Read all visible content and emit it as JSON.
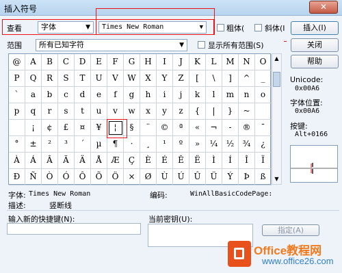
{
  "window": {
    "title": "插入符号",
    "close_glyph": "✕"
  },
  "toolbar": {
    "view_label": "查看",
    "font_mode_value": "字体",
    "font_name_value": "Times New Roman",
    "bold_label": "粗体(",
    "italic_label": "斜体(I",
    "insert_button": "插入(I)",
    "close_button": "关闭",
    "help_button": "帮助"
  },
  "range": {
    "label": "范围",
    "value": "所有已知字符",
    "show_all_label": "显示所有范围(S)"
  },
  "grid": {
    "rows": [
      [
        "@",
        "A",
        "B",
        "C",
        "D",
        "E",
        "F",
        "G",
        "H",
        "I",
        "J",
        "K",
        "L",
        "M",
        "N",
        "O"
      ],
      [
        "P",
        "Q",
        "R",
        "S",
        "T",
        "U",
        "V",
        "W",
        "X",
        "Y",
        "Z",
        "[",
        "\\",
        "]",
        "^",
        "_"
      ],
      [
        "`",
        "a",
        "b",
        "c",
        "d",
        "e",
        "f",
        "g",
        "h",
        "i",
        "j",
        "k",
        "l",
        "m",
        "n",
        "o"
      ],
      [
        "p",
        "q",
        "r",
        "s",
        "t",
        "u",
        "v",
        "w",
        "x",
        "y",
        "z",
        "{",
        "|",
        "}",
        "~",
        ""
      ],
      [
        "",
        "¡",
        "¢",
        "£",
        "¤",
        "¥",
        "¦",
        "§",
        "¨",
        "©",
        "ª",
        "«",
        "¬",
        "-",
        "®",
        "¯"
      ],
      [
        "°",
        "±",
        "²",
        "³",
        "´",
        "µ",
        "¶",
        "·",
        "¸",
        "¹",
        "º",
        "»",
        "¼",
        "½",
        "¾",
        "¿"
      ],
      [
        "À",
        "Á",
        "Â",
        "Ã",
        "Ä",
        "Å",
        "Æ",
        "Ç",
        "È",
        "É",
        "Ê",
        "Ë",
        "Ì",
        "Í",
        "Î",
        "Ï"
      ],
      [
        "Ð",
        "Ñ",
        "Ò",
        "Ó",
        "Ô",
        "Õ",
        "Ö",
        "×",
        "Ø",
        "Ù",
        "Ú",
        "Û",
        "Ü",
        "Ý",
        "Þ",
        "ß"
      ]
    ],
    "selected_row": 4,
    "selected_col": 6
  },
  "info": {
    "unicode_label": "Unicode:",
    "unicode_value": "0x00A6",
    "font_pos_label": "字体位置:",
    "font_pos_value": "0x00A6",
    "keystroke_label": "按键:",
    "keystroke_value": "Alt+0166"
  },
  "details": {
    "font_label": "字体:",
    "font_value": "Times New Roman",
    "encoding_label": "编码:",
    "encoding_value": "WinAllBasicCodePage:",
    "desc_label": "描述:",
    "desc_value": "竖断线"
  },
  "shortcut": {
    "new_label": "输入新的快捷键(N):",
    "current_label": "当前密钥(U):",
    "assign_button": "指定(A)"
  },
  "watermark": {
    "brand": "Office教程网",
    "url": "www.office26.com"
  }
}
